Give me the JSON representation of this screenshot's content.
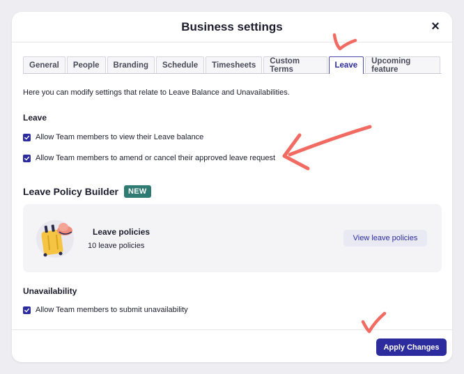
{
  "modal": {
    "title": "Business settings",
    "close_label": "×"
  },
  "tabs": [
    {
      "label": "General",
      "active": false
    },
    {
      "label": "People",
      "active": false
    },
    {
      "label": "Branding",
      "active": false
    },
    {
      "label": "Schedule",
      "active": false
    },
    {
      "label": "Timesheets",
      "active": false
    },
    {
      "label": "Custom Terms",
      "active": false
    },
    {
      "label": "Leave",
      "active": true
    },
    {
      "label": "Upcoming feature",
      "active": false
    }
  ],
  "description": "Here you can modify settings that relate to Leave Balance and Unavailabilities.",
  "leave": {
    "heading": "Leave",
    "options": [
      {
        "label": "Allow Team members to view their Leave balance",
        "checked": true
      },
      {
        "label": "Allow Team members to amend or cancel their approved leave request",
        "checked": true
      }
    ]
  },
  "policy_builder": {
    "title": "Leave Policy Builder",
    "badge": "NEW",
    "card_title": "Leave policies",
    "card_subtitle": "10 leave policies",
    "view_button": "View leave policies"
  },
  "unavailability": {
    "heading": "Unavailability",
    "options": [
      {
        "label": "Allow Team members to submit unavailability",
        "checked": true
      }
    ]
  },
  "footer": {
    "apply_button": "Apply Changes"
  },
  "colors": {
    "primary": "#2c2c9e",
    "badge": "#2f7a72",
    "annotation": "#f26b63",
    "luggage": "#f5c443"
  },
  "icons": {
    "close": "close-icon",
    "checkbox": "checkmark-icon",
    "illustration": "luggage-icon"
  }
}
